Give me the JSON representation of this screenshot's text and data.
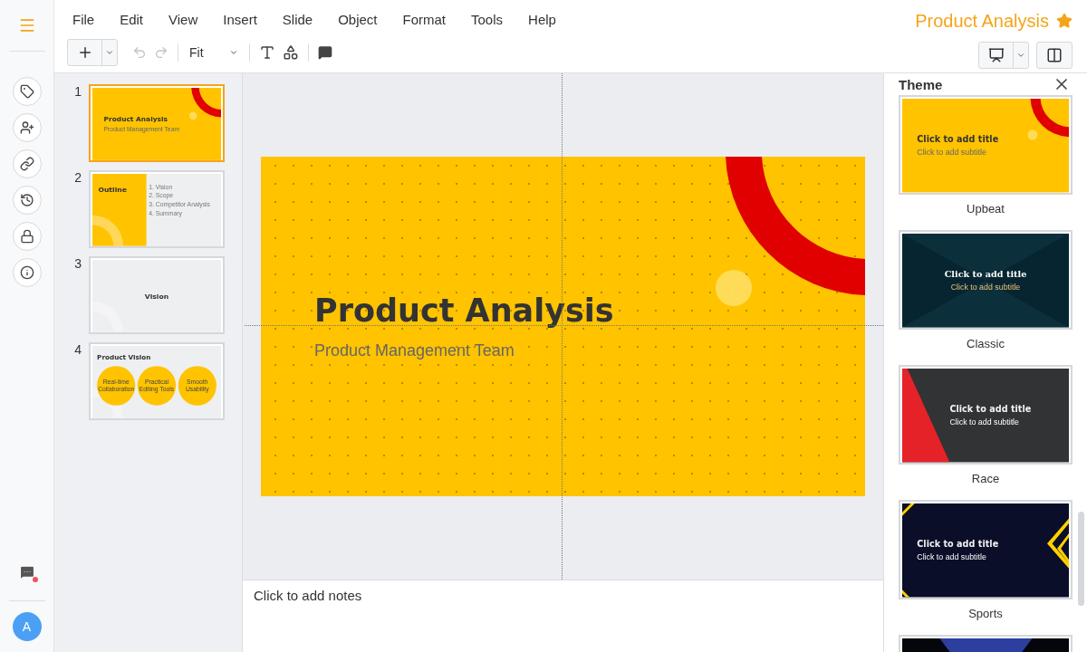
{
  "rail": {
    "items": [
      {
        "kind": "tag"
      },
      {
        "kind": "add-person"
      },
      {
        "kind": "link"
      },
      {
        "kind": "history"
      },
      {
        "kind": "lock"
      },
      {
        "kind": "info"
      }
    ],
    "chat_unread": true,
    "avatar": "A"
  },
  "menu": [
    "File",
    "Edit",
    "View",
    "Insert",
    "Slide",
    "Object",
    "Format",
    "Tools",
    "Help"
  ],
  "doc_title": "Product Analysis",
  "starred": true,
  "toolbar": {
    "undo_disabled": true,
    "redo_disabled": true,
    "zoom": "Fit"
  },
  "slides": [
    {
      "number": "1",
      "selected": true,
      "slide": {
        "kind": "title",
        "title": "Product Analysis",
        "subtitle": "Product Management Team"
      }
    },
    {
      "number": "2",
      "selected": false,
      "slide": {
        "kind": "outline",
        "title": "Outline",
        "items": [
          "1. Vision",
          "2. Scope",
          "3. Competitor Analysis",
          "4. Summary"
        ]
      }
    },
    {
      "number": "3",
      "selected": false,
      "slide": {
        "kind": "section",
        "title": "Vision"
      }
    },
    {
      "number": "4",
      "selected": false,
      "slide": {
        "kind": "circles",
        "title": "Product Vision",
        "items": [
          "Real-time Collaboration",
          "Practical Editing Tools",
          "Smooth Usability"
        ]
      }
    }
  ],
  "editor": {
    "slide": {
      "kind": "title",
      "title": "Product Analysis",
      "subtitle": "Product Management Team"
    },
    "notes": {
      "placeholder": "Click to add notes"
    }
  },
  "theme_panel": {
    "title": "Theme",
    "themes": [
      {
        "name": "Upbeat",
        "slide": {
          "kind": "title",
          "title": "Click to add title",
          "subtitle": "Click to add subtitle"
        }
      },
      {
        "name": "Classic",
        "slide": {
          "kind": "classic",
          "title": "Click to add title",
          "subtitle": "Click to add subtitle"
        }
      },
      {
        "name": "Race",
        "slide": {
          "kind": "race",
          "title": "Click to add title",
          "subtitle": "Click to add subtitle"
        }
      },
      {
        "name": "Sports",
        "slide": {
          "kind": "sports",
          "title": "Click to add title",
          "subtitle": "Click to add subtitle"
        }
      },
      {
        "slide": {
          "kind": "blue"
        }
      }
    ]
  }
}
